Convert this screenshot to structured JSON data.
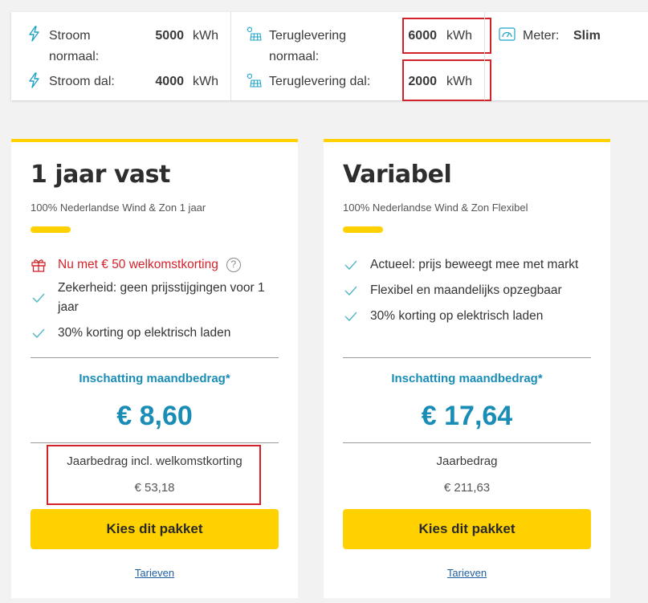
{
  "usage": {
    "stroom_normaal": {
      "label_line1": "Stroom",
      "label_line2": "normaal:",
      "value": "5000",
      "unit": "kWh"
    },
    "stroom_dal": {
      "label": "Stroom dal:",
      "value": "4000",
      "unit": "kWh"
    },
    "teruglevering_normaal": {
      "label_line1": "Teruglevering",
      "label_line2": "normaal:",
      "value": "6000",
      "unit": "kWh"
    },
    "teruglevering_dal": {
      "label": "Teruglevering dal:",
      "value": "2000",
      "unit": "kWh"
    },
    "meter": {
      "label": "Meter:",
      "value": "Slim"
    }
  },
  "icons": {
    "lightning": "lightning-icon",
    "solar": "solar-panel-icon",
    "meter": "meter-icon",
    "gift": "gift-icon",
    "check": "check-icon",
    "help": "help-icon"
  },
  "colors": {
    "accent_yellow": "#ffd100",
    "price_blue": "#1a8db6",
    "promo_red": "#d3222a",
    "check_teal": "#5bb8c9"
  },
  "cards": [
    {
      "title": "1 jaar vast",
      "subtitle": "100% Nederlandse Wind & Zon 1 jaar",
      "promo": "Nu met € 50 welkomstkorting",
      "help_symbol": "?",
      "features": [
        "Zekerheid: geen prijsstijgingen voor 1 jaar",
        "30% korting op elektrisch laden"
      ],
      "estimate_label": "Inschatting maandbedrag",
      "estimate_star": "*",
      "price": "€ 8,60",
      "year_label": "Jaarbedrag incl. welkomstkorting",
      "year_value": "€ 53,18",
      "button": "Kies dit pakket",
      "tarieven": "Tarieven"
    },
    {
      "title": "Variabel",
      "subtitle": "100% Nederlandse Wind & Zon Flexibel",
      "features": [
        "Actueel: prijs beweegt mee met markt",
        "Flexibel en maandelijks opzegbaar",
        "30% korting op elektrisch laden"
      ],
      "estimate_label": "Inschatting maandbedrag",
      "estimate_star": "*",
      "price": "€ 17,64",
      "year_label": "Jaarbedrag",
      "year_value": "€ 211,63",
      "button": "Kies dit pakket",
      "tarieven": "Tarieven"
    }
  ]
}
